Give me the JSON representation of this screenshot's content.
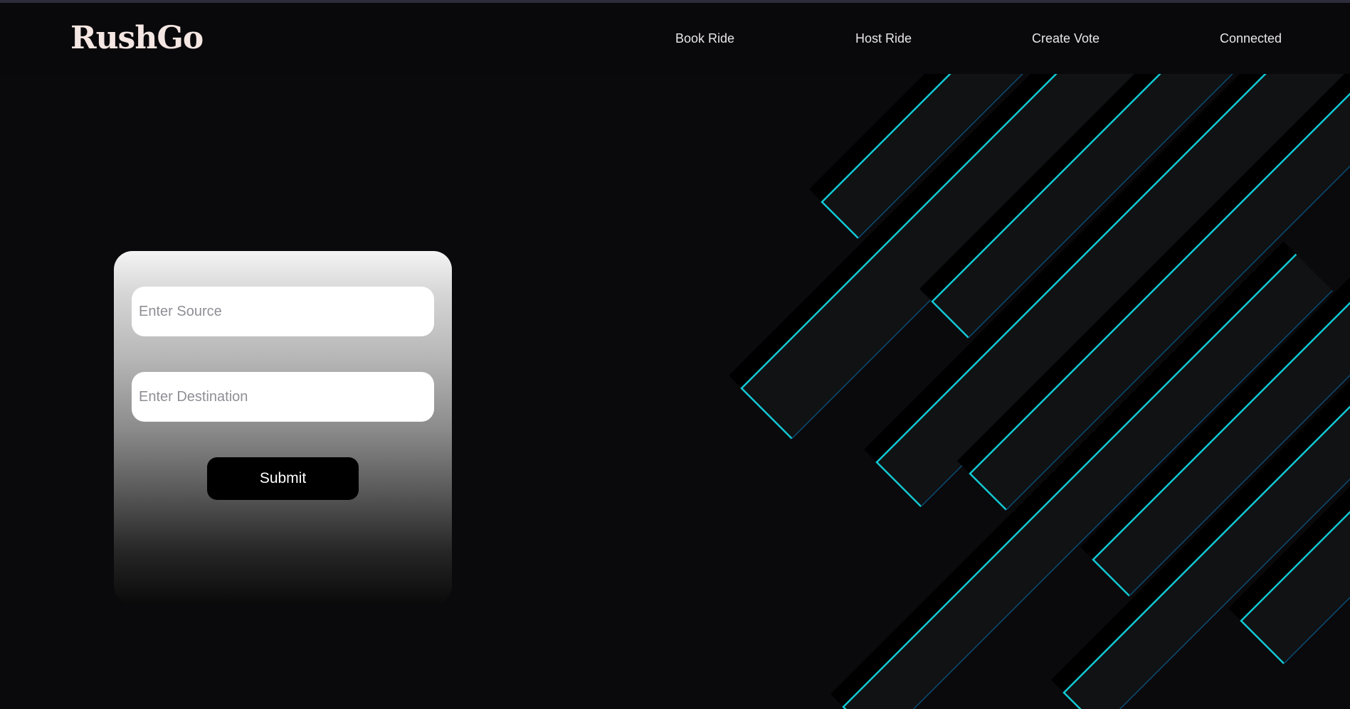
{
  "brand": {
    "name": "RushGo"
  },
  "nav": {
    "items": [
      {
        "label": "Book Ride"
      },
      {
        "label": "Host Ride"
      },
      {
        "label": "Create Vote"
      },
      {
        "label": "Connected"
      }
    ]
  },
  "form": {
    "source_placeholder": "Enter Source",
    "source_value": "",
    "destination_placeholder": "Enter Destination",
    "destination_value": "",
    "submit_label": "Submit"
  },
  "colors": {
    "background": "#0a090c",
    "brand_text": "#f4e6e2",
    "accent_cyan": "#0fc6d1",
    "button": "#000000"
  }
}
